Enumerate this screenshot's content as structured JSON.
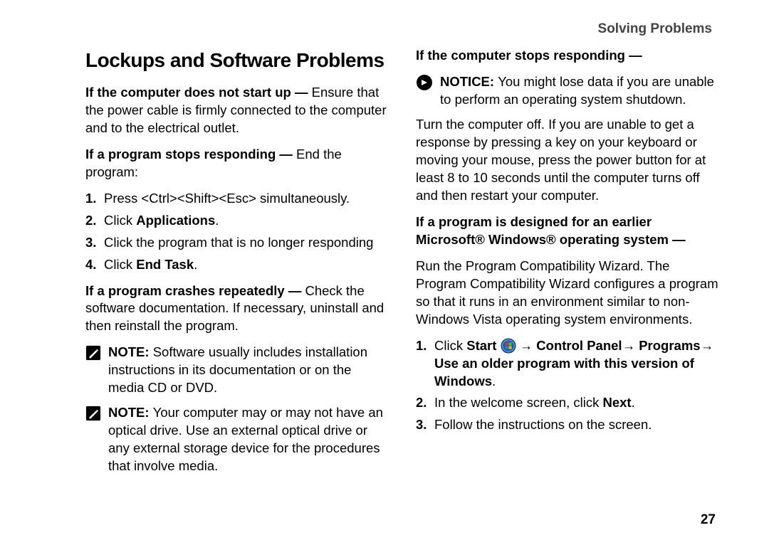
{
  "header": "Solving Problems",
  "page_number": "27",
  "left": {
    "heading": "Lockups and Software Problems",
    "p1_bold": "If the computer does not start up — ",
    "p1_rest": "Ensure that the power cable is firmly connected to the computer and to the electrical outlet.",
    "p2_bold": "If a program stops responding — ",
    "p2_rest": "End the program:",
    "steps": {
      "s1": "Press <Ctrl><Shift><Esc> simultaneously.",
      "s2a": "Click ",
      "s2b": "Applications",
      "s2c": ".",
      "s3": "Click the program that is no longer responding",
      "s4a": "Click ",
      "s4b": "End Task",
      "s4c": "."
    },
    "p3_bold": "If a program crashes repeatedly — ",
    "p3_rest": "Check the software documentation. If necessary, uninstall and then reinstall the program.",
    "note1_label": "NOTE: ",
    "note1_body": "Software usually includes installation instructions in its documentation or on the media CD or DVD.",
    "note2_label": "NOTE: ",
    "note2_body": "Your computer may or may not have an optical drive. Use an external optical drive or any external storage device for the procedures that involve media."
  },
  "right": {
    "p1_bold": "If the computer stops responding —",
    "notice_label": "NOTICE: ",
    "notice_body": "You might lose data if you are unable to perform an operating system shutdown.",
    "p2": "Turn the computer off. If you are unable to get a response by pressing a key on your keyboard or moving your mouse, press the power button for at least 8 to 10 seconds until the computer turns off and then restart your computer.",
    "p3_bold": "If a program is designed for an earlier Microsoft® Windows® operating system —",
    "p4": "Run the Program Compatibility Wizard. The Program Compatibility Wizard configures a program so that it runs in an environment similar to non-Windows Vista operating system environments.",
    "steps": {
      "s1a": "Click ",
      "s1b": "Start ",
      "s1c": " → Control Panel→ Programs→ Use an older program with this version of Windows",
      "s1d": ".",
      "s2a": "In the welcome screen, click ",
      "s2b": "Next",
      "s2c": ".",
      "s3": "Follow the instructions on the screen."
    }
  }
}
